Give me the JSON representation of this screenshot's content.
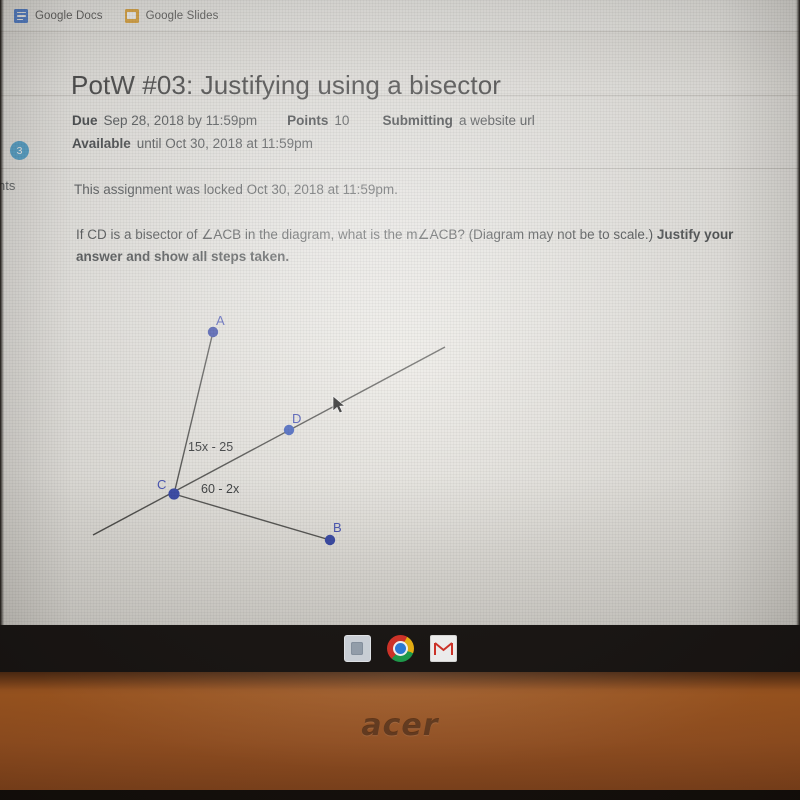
{
  "browser": {
    "bookmarks": [
      {
        "label": "Google Docs",
        "icon": "google-docs-icon"
      },
      {
        "label": "Google Slides",
        "icon": "google-slides-icon"
      }
    ]
  },
  "sidebar": {
    "badge_count": "3",
    "clipped_label": "nts"
  },
  "assignment": {
    "title": "PotW #03: Justifying using a bisector",
    "due_label": "Due",
    "due_value": "Sep 28, 2018 by 11:59pm",
    "points_label": "Points",
    "points_value": "10",
    "submitting_label": "Submitting",
    "submitting_value": "a website url",
    "available_label": "Available",
    "available_value": "until Oct 30, 2018 at 11:59pm",
    "locked_notice": "This assignment was locked Oct 30, 2018 at 11:59pm.",
    "question_part1": "If CD is a bisector of ∠ACB in the diagram, what is the m∠ACB? (Diagram may not be to scale.) ",
    "question_part2": "Justify your answer and show all steps taken."
  },
  "diagram": {
    "point_labels": {
      "a": "A",
      "b": "B",
      "c": "C",
      "d": "D"
    },
    "angle_expressions": {
      "acd": "15x - 25",
      "dcb": "60 - 2x"
    },
    "point_color": "#2c3fa8",
    "line_color": "#4a4a48",
    "label_color": "#3b49b5"
  },
  "shelf": {
    "icons": [
      "app-launcher-icon",
      "chrome-icon",
      "gmail-icon"
    ]
  },
  "hardware": {
    "brand": "acer"
  }
}
